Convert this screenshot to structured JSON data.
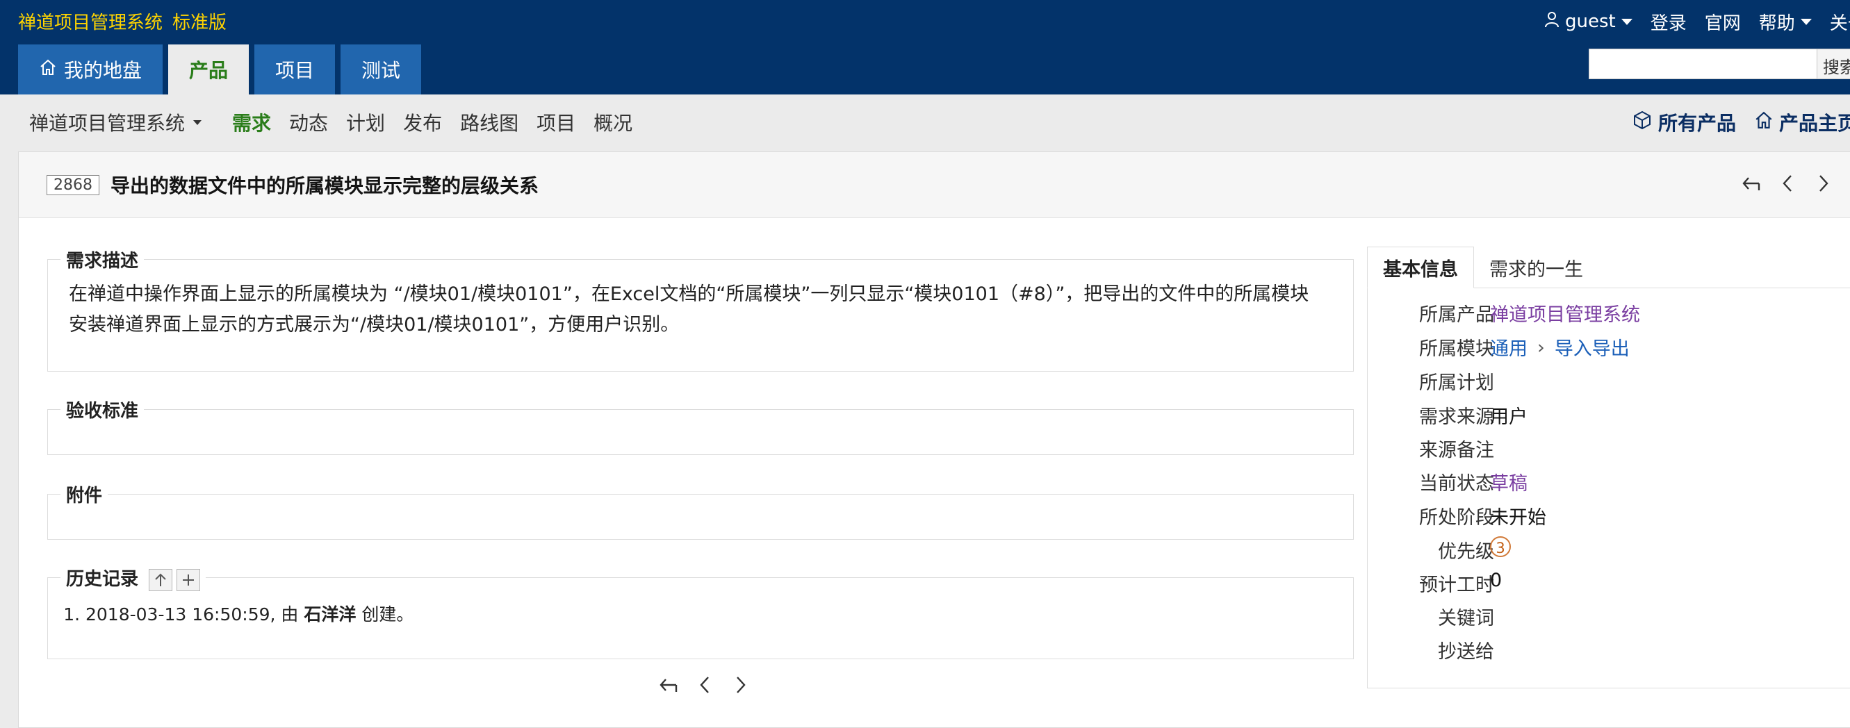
{
  "app": {
    "name": "禅道项目管理系统",
    "edition": "标准版"
  },
  "top_links": {
    "user": "guest",
    "login": "登录",
    "website": "官网",
    "help": "帮助",
    "about": "关于"
  },
  "main_nav": [
    {
      "label": "我的地盘",
      "active": false
    },
    {
      "label": "产品",
      "active": true
    },
    {
      "label": "项目",
      "active": false
    },
    {
      "label": "测试",
      "active": false
    }
  ],
  "search": {
    "button": "搜索",
    "placeholder": ""
  },
  "sub_nav": {
    "product_selector": "禅道项目管理系统",
    "items": [
      "需求",
      "动态",
      "计划",
      "发布",
      "路线图",
      "项目",
      "概况"
    ],
    "active": "需求",
    "right": {
      "all_products": "所有产品",
      "product_home": "产品主页"
    }
  },
  "story": {
    "id": "2868",
    "title": "导出的数据文件中的所属模块显示完整的层级关系"
  },
  "sections": {
    "description": {
      "legend": "需求描述",
      "lines": [
        "在禅道中操作界面上显示的所属模块为 “/模块01/模块0101”，在Excel文档的“所属模块”一列只显示“模块0101（#8）”，把导出的文件中的所属模块",
        "安装禅道界面上显示的方式展示为“/模块01/模块0101”，方便用户识别。"
      ]
    },
    "acceptance": {
      "legend": "验收标准"
    },
    "attachments": {
      "legend": "附件"
    },
    "history": {
      "legend": "历史记录",
      "entries": [
        {
          "time": "2018-03-13 16:50:59, 由 ",
          "user": "石洋洋",
          "action": " 创建。"
        }
      ]
    }
  },
  "side_panel": {
    "tabs": [
      "基本信息",
      "需求的一生"
    ],
    "fields": {
      "product": {
        "label": "所属产品",
        "value": "禅道项目管理系统"
      },
      "module": {
        "label": "所属模块",
        "values": [
          "通用",
          "导入导出"
        ]
      },
      "plan": {
        "label": "所属计划",
        "value": ""
      },
      "source": {
        "label": "需求来源",
        "value": "用户"
      },
      "source_note": {
        "label": "来源备注",
        "value": ""
      },
      "status": {
        "label": "当前状态",
        "value": "草稿"
      },
      "stage": {
        "label": "所处阶段",
        "value": "未开始"
      },
      "priority": {
        "label": "优先级",
        "value": "3"
      },
      "estimate": {
        "label": "预计工时",
        "value": "0"
      },
      "keywords": {
        "label": "关键词",
        "value": ""
      },
      "cc": {
        "label": "抄送给",
        "value": ""
      }
    }
  },
  "colors": {
    "header_bg": "#03336a",
    "nav_tab": "#2166ae",
    "brand": "#ffd400",
    "active_green": "#2a7d1a",
    "priority": "#d17a39"
  }
}
